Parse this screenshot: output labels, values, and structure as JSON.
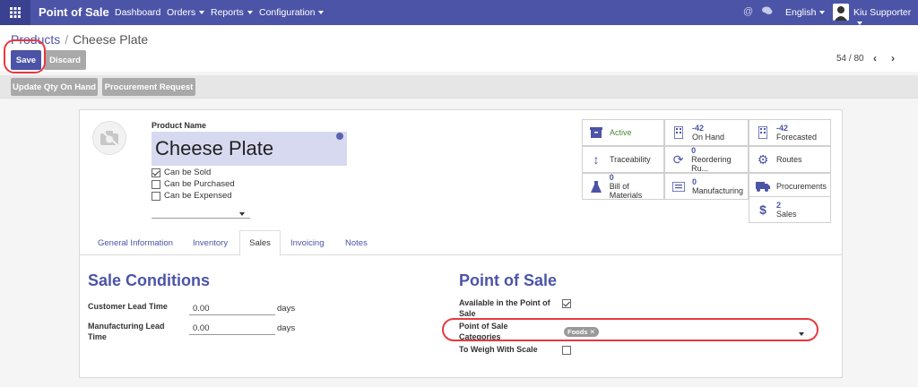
{
  "topbar": {
    "brand": "Point of Sale",
    "menus": [
      "Dashboard",
      "Orders",
      "Reports",
      "Configuration"
    ],
    "language": "English",
    "user": "Kiu Supporter"
  },
  "breadcrumb": {
    "parent": "Products",
    "current": "Cheese Plate"
  },
  "buttons": {
    "save": "Save",
    "discard": "Discard"
  },
  "pager": {
    "value": "54 / 80"
  },
  "header_buttons": [
    "Update Qty On Hand",
    "Procurement Request"
  ],
  "product": {
    "name_label": "Product Name",
    "name": "Cheese Plate",
    "options": [
      {
        "label": "Can be Sold",
        "checked": true
      },
      {
        "label": "Can be Purchased",
        "checked": false
      },
      {
        "label": "Can be Expensed",
        "checked": false
      }
    ]
  },
  "smart_buttons": {
    "active": "Active",
    "on_hand_num": "-42",
    "on_hand": "On Hand",
    "forecasted_num": "-42",
    "forecasted": "Forecasted",
    "traceability": "Traceability",
    "reordering_num": "0",
    "reordering": "Reordering Ru...",
    "routes": "Routes",
    "bom_num": "0",
    "bom": "Bill of Materials",
    "manufacturing_num": "0",
    "manufacturing": "Manufacturing",
    "procurements": "Procurements",
    "sales_num": "2",
    "sales": "Sales"
  },
  "tabs": [
    "General Information",
    "Inventory",
    "Sales",
    "Invoicing",
    "Notes"
  ],
  "sale_conditions": {
    "title": "Sale Conditions",
    "customer_lead_label": "Customer Lead Time",
    "customer_lead": "0.00",
    "manufacturing_lead_label": "Manufacturing Lead Time",
    "manufacturing_lead": "0.00",
    "unit": "days"
  },
  "pos": {
    "title": "Point of Sale",
    "available_label": "Available in the Point of Sale",
    "available": true,
    "categories_label": "Point of Sale Categories",
    "category_tag": "Foods",
    "weigh_label": "To Weigh With Scale",
    "weigh": false
  },
  "colors": {
    "primary": "#4c54a8",
    "highlight": "#e8383f",
    "active_green": "#4a8a35"
  }
}
